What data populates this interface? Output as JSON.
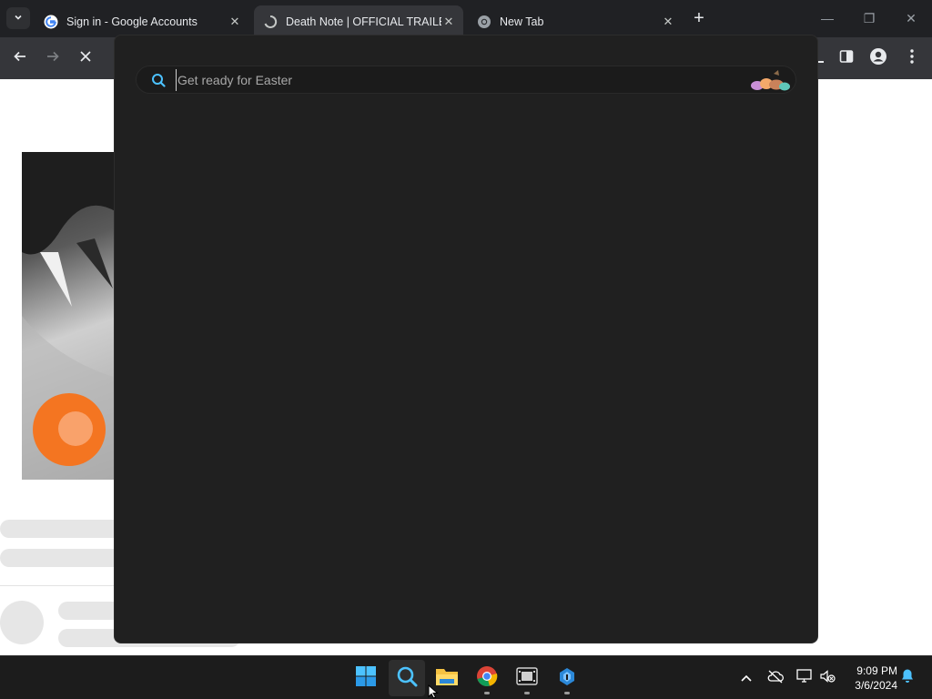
{
  "tabs": [
    {
      "title": "Sign in - Google Accounts",
      "favicon": "google-g-icon",
      "active": false
    },
    {
      "title": "Death Note | OFFICIAL TRAILER",
      "favicon": "loading-spinner-icon",
      "active": true
    },
    {
      "title": "New Tab",
      "favicon": "chrome-icon",
      "active": false
    }
  ],
  "search": {
    "placeholder": "Get ready for Easter"
  },
  "clock": {
    "time": "9:09 PM",
    "date": "3/6/2024"
  },
  "colors": {
    "tabstrip": "#202124",
    "toolbar": "#35363a",
    "flyout": "#202020",
    "taskbar": "#1c1c1c",
    "crunchyroll_orange": "#f47521",
    "search_accent": "#4cc2ff"
  },
  "taskbar_apps": [
    {
      "name": "start-button",
      "icon": "windows-logo-icon"
    },
    {
      "name": "search-button",
      "icon": "search-icon",
      "active": true
    },
    {
      "name": "file-explorer",
      "icon": "folder-icon"
    },
    {
      "name": "chrome",
      "icon": "chrome-icon",
      "running": true
    },
    {
      "name": "media-app",
      "icon": "film-icon",
      "running": true
    },
    {
      "name": "tool-app",
      "icon": "tool-icon",
      "running": true
    }
  ]
}
